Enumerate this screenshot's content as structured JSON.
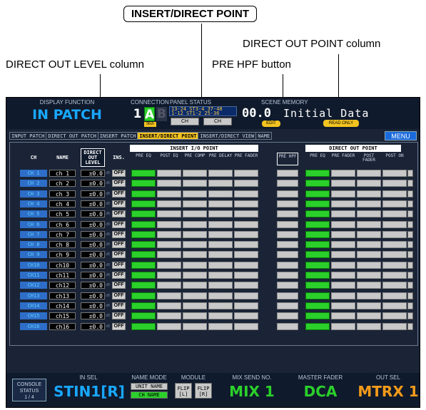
{
  "callouts": {
    "insert_direct_point": "INSERT/DIRECT POINT",
    "direct_out_point_column": "DIRECT OUT POINT column",
    "direct_out_level_column": "DIRECT OUT LEVEL column",
    "pre_hpf_button": "PRE HPF button"
  },
  "topbar": {
    "display_function_label": "DISPLAY FUNCTION",
    "display_function_value": "IN PATCH",
    "connection_label": "CONNECTION",
    "layer_1": "1",
    "layer_a": "A",
    "layer_b": "B",
    "layer_sub": "96ch",
    "panel_status_label": "PANEL STATUS",
    "panel_status_line1": "13-24 ST3-4 37-48",
    "panel_status_line2": "1-12 ST1-2 25-36",
    "ch_btn_1": "CH",
    "ch_btn_2": "CH",
    "scene_memory_label": "SCENE MEMORY",
    "scene_number": "00.0",
    "scene_title": "Initial Data",
    "edit_badge": "EDIT",
    "read_only_badge": "READ ONLY"
  },
  "tabs": [
    {
      "label": "INPUT PATCH"
    },
    {
      "label": "DIRECT OUT PATCH"
    },
    {
      "label": "INSERT PATCH"
    },
    {
      "label": "INSERT/DIRECT POINT"
    },
    {
      "label": "INSERT/DIRECT VIEW"
    },
    {
      "label": "NAME"
    }
  ],
  "menu_label": "MENU",
  "table": {
    "col_ch": "CH",
    "col_name": "NAME",
    "col_direct_out_level": "DIRECT OUT LEVEL",
    "col_ins": "INS.",
    "insert_group_title": "INSERT I/O POINT",
    "insert_cols": [
      "PRE EQ",
      "POST EQ",
      "PRE COMP",
      "PRE DELAY",
      "PRE FADER"
    ],
    "pre_hpf": "PRE HPF",
    "direct_group_title": "DIRECT OUT POINT",
    "direct_cols": [
      "PRE EQ",
      "PRE FADER",
      "POST FADER",
      "POST ON"
    ],
    "rows": [
      {
        "ch": "CH 1",
        "name": "ch 1",
        "level": "±0.0",
        "ins": "OFF"
      },
      {
        "ch": "CH 2",
        "name": "ch 2",
        "level": "±0.0",
        "ins": "OFF"
      },
      {
        "ch": "CH 3",
        "name": "ch 3",
        "level": "±0.0",
        "ins": "OFF"
      },
      {
        "ch": "CH 4",
        "name": "ch 4",
        "level": "±0.0",
        "ins": "OFF"
      },
      {
        "ch": "CH 5",
        "name": "ch 5",
        "level": "±0.0",
        "ins": "OFF"
      },
      {
        "ch": "CH 6",
        "name": "ch 6",
        "level": "±0.0",
        "ins": "OFF"
      },
      {
        "ch": "CH 7",
        "name": "ch 7",
        "level": "±0.0",
        "ins": "OFF"
      },
      {
        "ch": "CH 8",
        "name": "ch 8",
        "level": "±0.0",
        "ins": "OFF"
      },
      {
        "ch": "CH 9",
        "name": "ch 9",
        "level": "±0.0",
        "ins": "OFF"
      },
      {
        "ch": "CH10",
        "name": "ch10",
        "level": "±0.0",
        "ins": "OFF"
      },
      {
        "ch": "CH11",
        "name": "ch11",
        "level": "±0.0",
        "ins": "OFF"
      },
      {
        "ch": "CH12",
        "name": "ch12",
        "level": "±0.0",
        "ins": "OFF"
      },
      {
        "ch": "CH13",
        "name": "ch13",
        "level": "±0.0",
        "ins": "OFF"
      },
      {
        "ch": "CH14",
        "name": "ch14",
        "level": "±0.0",
        "ins": "OFF"
      },
      {
        "ch": "CH15",
        "name": "ch15",
        "level": "±0.0",
        "ins": "OFF"
      },
      {
        "ch": "CH16",
        "name": "ch16",
        "level": "±0.0",
        "ins": "OFF"
      }
    ],
    "db_unit": "dB"
  },
  "bottom": {
    "console_status_label": "CONSOLE STATUS",
    "console_status_page": "1 / 4",
    "in_sel_label": "IN SEL",
    "in_sel_value": "STIN1[R]",
    "name_mode_label": "NAME MODE",
    "unit_name_btn": "UNIT NAME",
    "ch_name_btn": "CH NAME",
    "module_label": "MODULE",
    "flip_l": "FLIP [L]",
    "flip_r": "FLIP [R]",
    "mix_send_label": "MIX SEND NO.",
    "mix_send_value": "MIX 1",
    "master_fader_label": "MASTER FADER",
    "master_fader_value": "DCA",
    "out_sel_label": "OUT SEL",
    "out_sel_value": "MTRX 1"
  },
  "colors": {
    "accent_blue": "#19a8ff",
    "active_green": "#2bd02b",
    "out_sel_orange": "#f39a1a",
    "tab_active_yellow": "#f3c320"
  }
}
